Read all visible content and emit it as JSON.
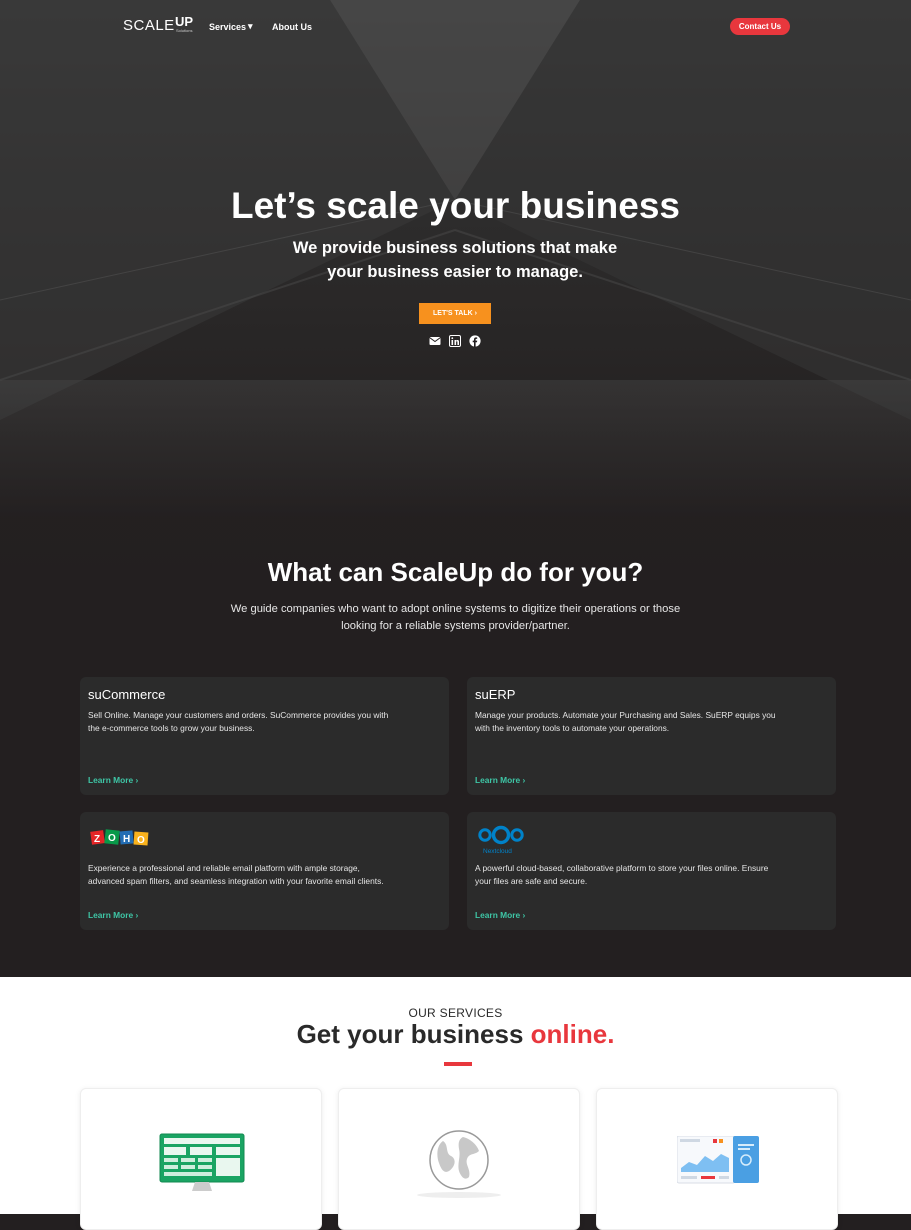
{
  "nav": {
    "logo_word": "SCALE",
    "logo_up": "UP",
    "logo_sub": "Solutions",
    "services_label": "Services",
    "about_label": "About Us",
    "contact_label": "Contact Us"
  },
  "hero": {
    "title": "Let’s scale your business",
    "subtitle_line1": "We provide business solutions that make",
    "subtitle_line2": "your business easier to manage.",
    "cta_label": "LET'S TALK",
    "social_icons": [
      "mail-icon",
      "linkedin-icon",
      "facebook-icon"
    ]
  },
  "what": {
    "title": "What can ScaleUp do for you?",
    "desc_line1": "We guide companies who want to adopt online systems to digitize their operations or those",
    "desc_line2": "looking for a reliable systems provider/partner."
  },
  "cards": [
    {
      "title": "suCommerce",
      "text_line1": "Sell Online. Manage your customers and orders. SuCommerce provides you with",
      "text_line2": "the e-commerce tools to grow your business.",
      "link": "Learn More"
    },
    {
      "title": "suERP",
      "text_line1": "Manage your products. Automate your Purchasing and Sales. SuERP equips you",
      "text_line2": "with the inventory tools to automate your operations.",
      "link": "Learn More"
    },
    {
      "logo_text": "ZOHO",
      "text_line1": "Experience a professional and reliable email platform with ample storage,",
      "text_line2": "advanced spam filters, and seamless integration with your favorite email clients.",
      "link": "Learn More"
    },
    {
      "logo_text": "Nextcloud",
      "text_line1": "A powerful cloud-based, collaborative platform to store your files online. Ensure",
      "text_line2": "your files are safe and secure.",
      "link": "Learn More"
    }
  ],
  "services": {
    "label": "OUR SERVICES",
    "title_main": "Get your business ",
    "title_accent": "online."
  },
  "colors": {
    "accent_red": "#e8373d",
    "cta_orange": "#f7911e",
    "link_green": "#3ec6a6",
    "background_dark": "#231f20"
  }
}
